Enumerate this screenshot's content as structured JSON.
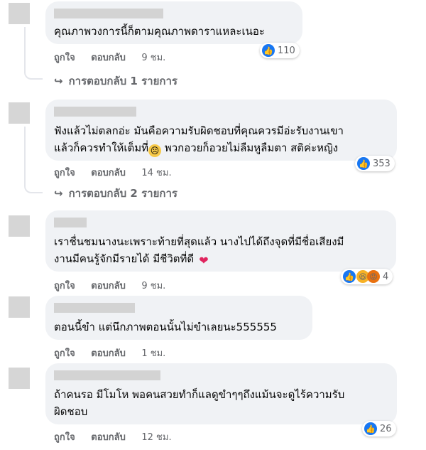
{
  "comments": [
    {
      "lines": [
        "คุณภาพวงการนี้ก็ตามคุณภาพดาราแหละเนอะ"
      ],
      "like": "ถูกใจ",
      "reply": "ตอบกลับ",
      "time": "9 ชม.",
      "reaction_count": "110",
      "replies_label": "การตอบกลับ 1 รายการ"
    },
    {
      "lines": [
        "ฟังแล้วไม่ตลกอ่ะ มันคือความรับผิดชอบที่คุณควรมีอ่ะรับงานเขา",
        "แล้วก็ควรทำให้เต็มที่",
        " พวกอวยก็อวยไม่ลืมหูลืมตา สติค่ะหญิง"
      ],
      "like": "ถูกใจ",
      "reply": "ตอบกลับ",
      "time": "14 ชม.",
      "reaction_count": "353",
      "replies_label": "การตอบกลับ 2 รายการ"
    },
    {
      "lines": [
        "เราชื่นชมนางนะเพราะท้ายที่สุดแล้ว นางไปได้ถึงจุดที่มีชื่อเสียงมี",
        "งานมีคนรู้จักมีรายได้ มีชีวิตที่ดี "
      ],
      "like": "ถูกใจ",
      "reply": "ตอบกลับ",
      "time": "9 ชม.",
      "reaction_count": "4"
    },
    {
      "lines": [
        "ตอนนี้ขำ แต่นึกภาพตอนนั้นไม่ขำเลยนะ555555"
      ],
      "like": "ถูกใจ",
      "reply": "ตอบกลับ",
      "time": "1 ชม."
    },
    {
      "lines": [
        "ถ้าคนรอ มีโมโห พอคนสวยทำก็แลดูขำๆๆถึงแม้นจะดูไร้ความรับ",
        "ผิดชอบ"
      ],
      "like": "ถูกใจ",
      "reply": "ตอบกลับ",
      "time": "12 ชม.",
      "reaction_count": "26"
    }
  ],
  "icons": {
    "like": "thumbs-up-icon",
    "haha": "laughing-face-icon",
    "angry": "angry-face-icon",
    "reply_arrow": "reply-arrow-icon",
    "sad_emoji": "sad-face-emoji",
    "heart_emoji": "heart-emoji"
  }
}
